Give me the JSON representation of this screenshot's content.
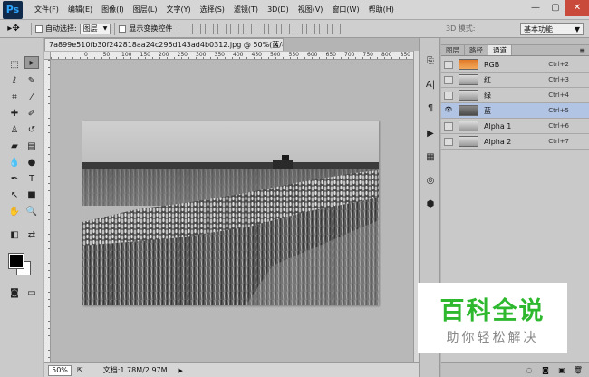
{
  "app": {
    "logo": "Ps",
    "menu": [
      "文件(F)",
      "编辑(E)",
      "图像(I)",
      "图层(L)",
      "文字(Y)",
      "选择(S)",
      "滤镜(T)",
      "3D(D)",
      "视图(V)",
      "窗口(W)",
      "帮助(H)"
    ],
    "window_controls": [
      "—",
      "▢",
      "✕"
    ]
  },
  "options_bar": {
    "auto_select_label": "自动选择:",
    "auto_select_value": "图层",
    "show_transform_label": "显示变换控件",
    "mode_3d_label": "3D 模式:",
    "workspace_value": "基本功能"
  },
  "document": {
    "tab_title": "7a899e510fb30f242818aa24c295d143ad4b0312.jpg @ 50%(蓝/8) *",
    "ruler_numbers": [
      "0",
      "50",
      "100",
      "150",
      "200",
      "250",
      "300",
      "350",
      "400",
      "450",
      "500",
      "550",
      "600",
      "650",
      "700",
      "750",
      "800",
      "850",
      "900"
    ],
    "zoom": "50%",
    "status_text": "文档:1.78M/2.97M"
  },
  "panel": {
    "tabs": [
      "图层",
      "路径",
      "通道"
    ],
    "active_tab": 2,
    "channels": [
      {
        "name": "RGB",
        "shortcut": "Ctrl+2",
        "visible": false,
        "selected": false,
        "thumb": "color"
      },
      {
        "name": "红",
        "shortcut": "Ctrl+3",
        "visible": false,
        "selected": false,
        "thumb": "light"
      },
      {
        "name": "绿",
        "shortcut": "Ctrl+4",
        "visible": false,
        "selected": false,
        "thumb": "light"
      },
      {
        "name": "蓝",
        "shortcut": "Ctrl+5",
        "visible": true,
        "selected": true,
        "thumb": "dark"
      },
      {
        "name": "Alpha 1",
        "shortcut": "Ctrl+6",
        "visible": false,
        "selected": false,
        "thumb": "light"
      },
      {
        "name": "Alpha 2",
        "shortcut": "Ctrl+7",
        "visible": false,
        "selected": false,
        "thumb": "light"
      }
    ]
  },
  "watermark": {
    "main": "百科全说",
    "sub": "助你轻松解决",
    "color": "#2eb82e"
  },
  "colors": {
    "selected_row": "#b2c4e4",
    "ps_blue": "#2ea6ff"
  }
}
